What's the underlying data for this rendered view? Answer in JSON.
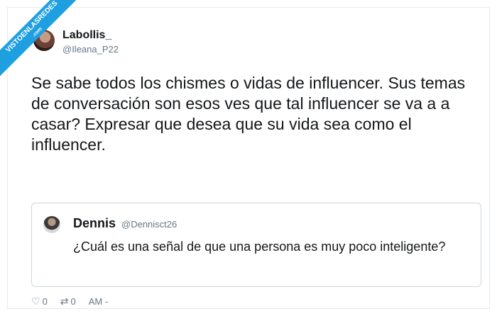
{
  "watermark": {
    "text": "VISTOENLASREDES",
    "domain": ".com",
    "color": "#1e9fe0"
  },
  "author": {
    "name": "Labollis_",
    "handle": "@Ileana_P22"
  },
  "tweet": {
    "text": "Se sabe todos los chismes o vidas de influencer. Sus temas de conversación son esos ves que tal influencer se va a a casar? Expresar que desea que su vida sea como el influencer."
  },
  "quoted": {
    "name": "Dennis",
    "handle": "@Dennisct26",
    "text": "¿Cuál es una señal de que una persona es muy poco inteligente?"
  },
  "actions": {
    "likes": "0",
    "retweets": "0",
    "time": "AM -",
    "like_icon": "heart-icon",
    "retweet_icon": "retweet-icon"
  }
}
